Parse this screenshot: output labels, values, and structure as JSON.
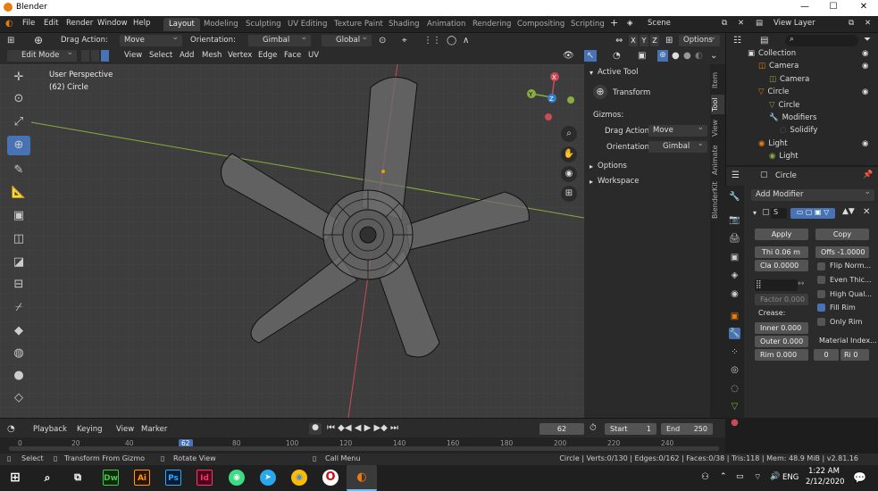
{
  "window": {
    "title": "Blender",
    "min": "—",
    "max": "☐",
    "close": "✕"
  },
  "menu": [
    "File",
    "Edit",
    "Render",
    "Window",
    "Help"
  ],
  "workspaces": [
    "Layout",
    "Modeling",
    "Sculpting",
    "UV Editing",
    "Texture Paint",
    "Shading",
    "Animation",
    "Rendering",
    "Compositing",
    "Scripting"
  ],
  "scene": "Scene",
  "view_layer": "View Layer",
  "toolbar": {
    "drag_label": "Drag Action:",
    "drag_value": "Move",
    "orient_label": "Orientation:",
    "orient_value": "Gimbal",
    "pivot_value": "Global",
    "options": "Options",
    "x": "X",
    "y": "Y",
    "z": "Z"
  },
  "viewport_header": {
    "mode": "Edit Mode",
    "menus": [
      "View",
      "Select",
      "Add",
      "Mesh",
      "Vertex",
      "Edge",
      "Face",
      "UV"
    ]
  },
  "viewport": {
    "perspective": "User Perspective",
    "object": "(62) Circle"
  },
  "npanel": {
    "active_tool": "Active Tool",
    "tool": "Transform",
    "gizmos": "Gizmos:",
    "drag_label": "Drag Action",
    "drag_value": "Move",
    "orient_label": "Orientation",
    "orient_value": "Gimbal",
    "options": "Options",
    "workspace": "Workspace",
    "tabs": [
      "Item",
      "Tool",
      "View",
      "Animate",
      "BlenderKit"
    ]
  },
  "outliner": {
    "items": [
      {
        "label": "Collection",
        "indent": 0,
        "icon": "collection-icon"
      },
      {
        "label": "Camera",
        "indent": 1,
        "icon": "camera-icon"
      },
      {
        "label": "Camera",
        "indent": 2,
        "icon": "camera-data-icon"
      },
      {
        "label": "Circle",
        "indent": 1,
        "icon": "mesh-icon"
      },
      {
        "label": "Circle",
        "indent": 2,
        "icon": "mesh-data-icon"
      },
      {
        "label": "Modifiers",
        "indent": 2,
        "icon": "wrench-icon"
      },
      {
        "label": "Solidify",
        "indent": 3,
        "icon": "modifier-icon"
      },
      {
        "label": "Light",
        "indent": 1,
        "icon": "light-icon"
      },
      {
        "label": "Light",
        "indent": 2,
        "icon": "light-data-icon"
      }
    ]
  },
  "properties": {
    "object": "Circle",
    "add_modifier": "Add Modifier",
    "mod_name": "S",
    "apply": "Apply",
    "copy": "Copy",
    "thickness_label": "Thi",
    "thickness": "0.06 m",
    "offset_label": "Offs",
    "offset": "-1.0000",
    "clamp_label": "Cla",
    "clamp": "0.0000",
    "flip_normals": "Flip Norm...",
    "even_thickness": "Even Thic...",
    "high_quality": "High Qual...",
    "fill_rim": "Fill Rim",
    "only_rim": "Only Rim",
    "factor_label": "Factor",
    "factor": "0.000",
    "crease_label": "Crease:",
    "inner_label": "Inner",
    "inner": "0.000",
    "outer_label": "Outer",
    "outer": "0.000",
    "rim_label": "Rim",
    "rim": "0.000",
    "material_index": "Material Index...",
    "mat_a": "0",
    "mat_b_label": "Ri",
    "mat_b": "0"
  },
  "timeline": {
    "menus": [
      "Playback",
      "Keying",
      "View",
      "Marker"
    ],
    "current": "62",
    "start_label": "Start",
    "start": "1",
    "end_label": "End",
    "end": "250",
    "ruler": [
      "0",
      "20",
      "40",
      "62",
      "80",
      "100",
      "120",
      "140",
      "160",
      "180",
      "200",
      "220",
      "240"
    ]
  },
  "status": {
    "select": "Select",
    "transform": "Transform From Gizmo",
    "rotate": "Rotate View",
    "call_menu": "Call Menu",
    "stats": "Circle | Verts:0/130 | Edges:0/162 | Faces:0/38 | Tris:118 | Mem: 48.9 MiB | v2.81.16"
  },
  "taskbar": {
    "time": "1:22 AM",
    "date": "2/12/2020",
    "lang": "ENG",
    "apps": [
      "Dw",
      "Ai",
      "Ps",
      "Id"
    ]
  },
  "colors": {
    "accent": "#4772b3",
    "axis_x": "#c8394a",
    "axis_y": "#7ba32f",
    "axis_z": "#2e7ed6"
  }
}
